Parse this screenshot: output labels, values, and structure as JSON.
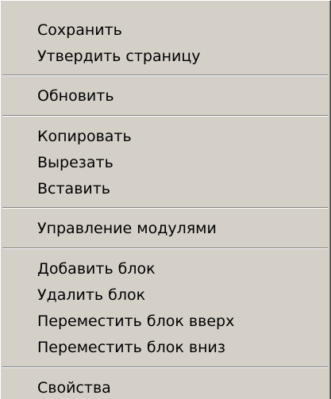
{
  "context_menu": {
    "items": [
      {
        "label": "Сохранить"
      },
      {
        "label": "Утвердить страницу"
      },
      {
        "label": "Обновить"
      },
      {
        "label": "Копировать"
      },
      {
        "label": "Вырезать"
      },
      {
        "label": "Вставить"
      },
      {
        "label": "Управление модулями"
      },
      {
        "label": "Добавить блок"
      },
      {
        "label": "Удалить блок"
      },
      {
        "label": "Переместить блок вверх"
      },
      {
        "label": "Переместить блок вниз"
      },
      {
        "label": "Свойства"
      }
    ]
  },
  "colors": {
    "menu_background": "#d4d0c8",
    "separator_shadow": "#808080",
    "separator_highlight": "#ffffff",
    "text": "#000000"
  }
}
